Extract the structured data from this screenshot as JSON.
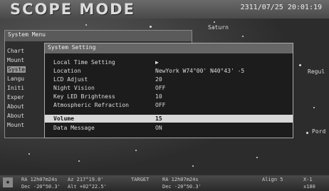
{
  "header": {
    "mode_title": "SCOPE MODE",
    "datetime": "2311/07/25 20:01:19"
  },
  "sky": {
    "labels": [
      "Saturn",
      "Regul",
      "Pord"
    ]
  },
  "system_menu": {
    "title": "System Menu",
    "items": [
      "Chart",
      "Mount",
      "Syste",
      "Langu",
      "Initi",
      "Exper",
      "About",
      "About",
      "Mount"
    ],
    "selected_index": 2
  },
  "system_setting": {
    "title": "System Setting",
    "rows": [
      {
        "label": "Local Time Setting",
        "value": "▶"
      },
      {
        "label": "Location",
        "value": "NewYork W74°00' N40°43' -5"
      },
      {
        "label": "LCD Adjust",
        "value": "20"
      },
      {
        "label": "Night Vision",
        "value": "OFF"
      },
      {
        "label": "Key LED Brightness",
        "value": "10"
      },
      {
        "label": "Atmospheric Refraction",
        "value": "OFF"
      },
      {
        "label": "Volume",
        "value": "15"
      },
      {
        "label": "Data Message",
        "value": "ON"
      }
    ],
    "selected_index": 6
  },
  "status_bar": {
    "ra1": "RA 12h07m24s",
    "dec1": "Dec -20°50.3'",
    "az": "Az 217°19.0'",
    "alt": "Alt +02°22.5'",
    "target": "TARGET",
    "ra2": "RA 12h07m24s",
    "dec2": "Dec -20°50.3'",
    "align": "Align 5",
    "zoom": "X-1",
    "fov": "x180"
  }
}
